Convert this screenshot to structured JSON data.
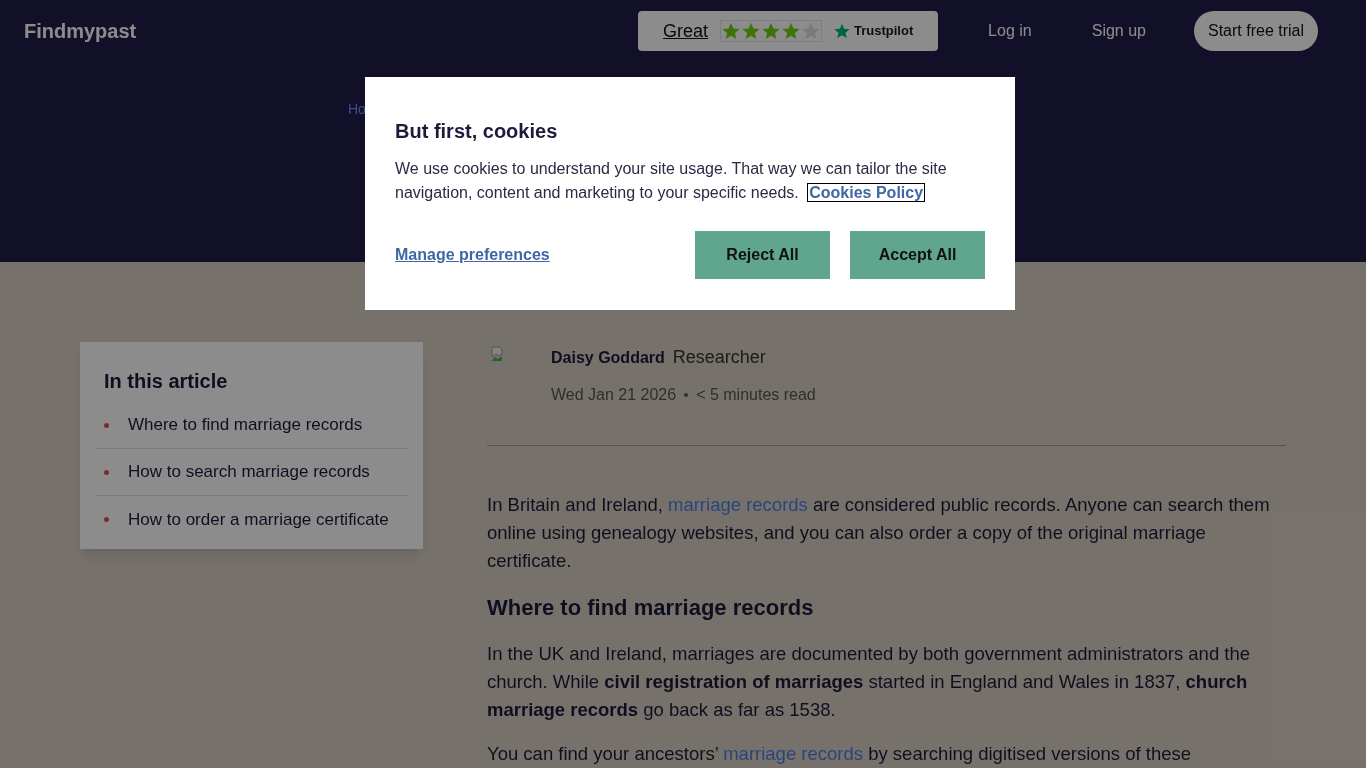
{
  "header": {
    "logo": "Findmypast",
    "rating": {
      "label": "Great",
      "stars": 4,
      "brand": "Trustpilot"
    },
    "nav": [
      "Log in",
      "Sign up"
    ],
    "cta": "Start free trial"
  },
  "hero": {
    "breadcrumb": "Ho"
  },
  "toc": {
    "title": "In this article",
    "items": [
      "Where to find marriage records",
      "How to search marriage records",
      "How to order a marriage certificate"
    ]
  },
  "author": {
    "name": "Daisy Goddard",
    "role": "Researcher",
    "date": "Wed Jan 21 2026",
    "read_time": "< 5 minutes read"
  },
  "article": [
    {
      "kind": "para",
      "parts": [
        {
          "text": "In Britain and Ireland, "
        },
        {
          "text": "marriage records",
          "link": true
        },
        {
          "text": " are considered public records. Anyone can search them online using genealogy websites, and you can also order a copy of the original marriage certificate."
        }
      ]
    },
    {
      "kind": "heading",
      "text": "Where to find marriage records"
    },
    {
      "kind": "para",
      "parts": [
        {
          "text": "In the UK and Ireland, marriages are documented by both government administrators and the church. While **civil registration of marriages** started in England and Wales in 1837, **church marriage records** go back as far as 1538."
        }
      ]
    },
    {
      "kind": "para",
      "parts": [
        {
          "text": "You can find your ancestors’ "
        },
        {
          "text": "marriage records",
          "link": true
        },
        {
          "text": " by searching digitised versions of these"
        }
      ]
    }
  ],
  "cookie_dialog": {
    "title": "But first, cookies",
    "text": "We use cookies to understand your site usage. That way we can tailor the site navigation, content and marketing to your specific needs.",
    "policy_link": "Cookies Policy",
    "manage": "Manage preferences",
    "buttons": [
      "Reject All",
      "Accept All"
    ]
  }
}
